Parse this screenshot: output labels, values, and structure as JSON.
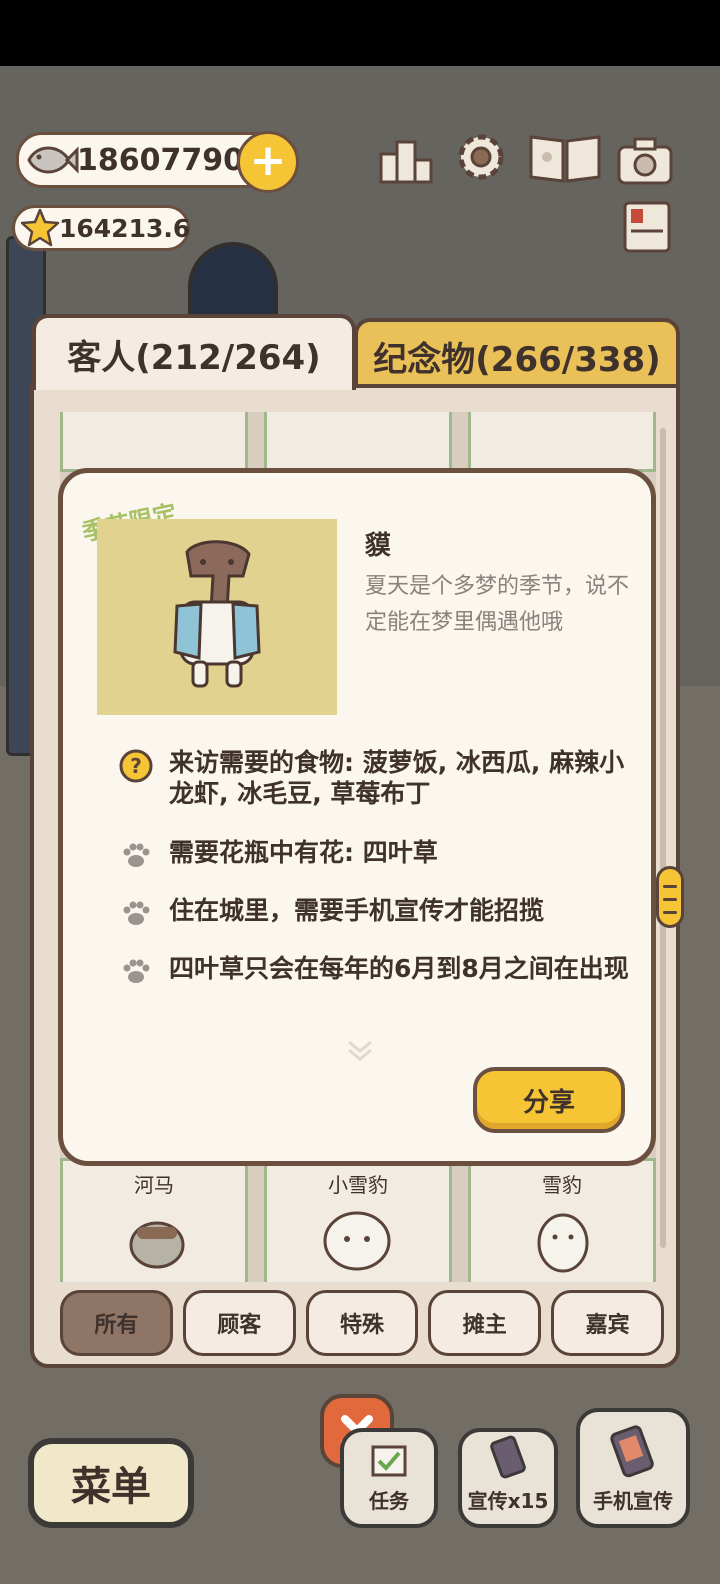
{
  "hud": {
    "fish_count": "18607790",
    "star_count": "164213.6",
    "icons": [
      "fish-icon",
      "plus-icon",
      "star-icon",
      "ranking-icon",
      "gear-icon",
      "book-icon",
      "camera-icon",
      "notebook-icon"
    ]
  },
  "tabs": {
    "guests": "客人(212/264)",
    "souvenirs": "纪念物(266/338)"
  },
  "grid": {
    "bottom_labels": [
      "河马",
      "小雪豹",
      "雪豹"
    ]
  },
  "detail": {
    "season_tag": "季节限定",
    "name": "貘",
    "description": "夏天是个多梦的季节，说不定能在梦里偶遇他哦",
    "requirements": [
      {
        "icon": "question-icon",
        "text": "来访需要的食物: 菠萝饭, 冰西瓜, 麻辣小龙虾, 冰毛豆, 草莓布丁"
      },
      {
        "icon": "paw-icon",
        "text": "需要花瓶中有花: 四叶草"
      },
      {
        "icon": "paw-icon",
        "text": "住在城里，需要手机宣传才能招揽"
      },
      {
        "icon": "paw-icon",
        "text": "四叶草只会在每年的6月到8月之间在出现"
      }
    ],
    "share_label": "分享"
  },
  "filters": [
    "所有",
    "顾客",
    "特殊",
    "摊主",
    "嘉宾"
  ],
  "bottom": {
    "menu_label": "菜单",
    "task_label": "任务",
    "promo_label": "宣传x15",
    "phone_promo_label": "手机宣传"
  },
  "colors": {
    "accent_yellow": "#f5c536",
    "outline_brown": "#5a4338",
    "card_bg": "#fbf6ee",
    "season_green": "#a7c264",
    "close_orange": "#e2693b"
  }
}
